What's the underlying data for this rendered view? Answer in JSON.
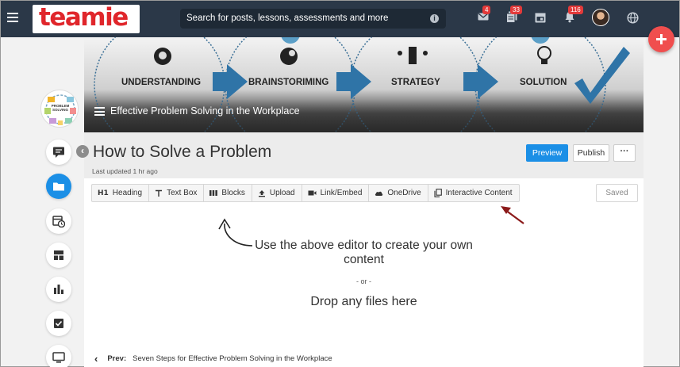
{
  "header": {
    "logo_text": "teamie",
    "search_placeholder": "Search for posts, lessons, assessments and more",
    "icons": [
      {
        "name": "messages-icon",
        "badge": "4"
      },
      {
        "name": "posts-icon",
        "badge": "33"
      },
      {
        "name": "calendar-icon",
        "badge": ""
      },
      {
        "name": "notifications-icon",
        "badge": "116"
      }
    ]
  },
  "banner": {
    "steps": [
      "UNDERSTANDING",
      "BRAINSTORIMING",
      "STRATEGY",
      "SOLUTION"
    ],
    "course_title": "Effective Problem Solving in the Workplace",
    "thumb_text": "PROBLEM SOLVING"
  },
  "lesson": {
    "title": "How to Solve a Problem",
    "last_updated": "Last updated 1 hr ago",
    "preview_label": "Preview",
    "publish_label": "Publish",
    "more_label": "···",
    "saved_label": "Saved"
  },
  "toolbar": {
    "h1_glyph": "H1",
    "heading": "Heading",
    "textbox": "Text Box",
    "blocks": "Blocks",
    "upload": "Upload",
    "link_embed": "Link/Embed",
    "onedrive": "OneDrive",
    "interactive": "Interactive Content"
  },
  "editor": {
    "hint": "Use the above editor to create your own content",
    "or": "- or -",
    "drop": "Drop any files here"
  },
  "nav": {
    "prev_label": "Prev:",
    "prev_title": "Seven Steps for Effective Problem Solving in the Workplace"
  },
  "colors": {
    "topbar": "#2b3848",
    "accent": "#1b8fe6",
    "badge": "#e33a3a",
    "fab": "#f04e4e",
    "annotation_arrow": "#8b1a1a"
  }
}
